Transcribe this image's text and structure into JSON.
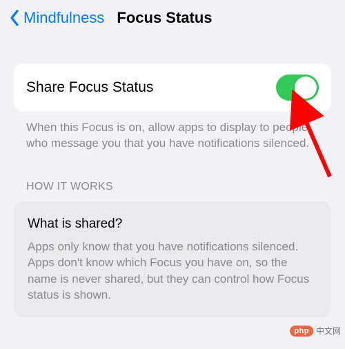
{
  "navbar": {
    "back_label": "Mindfulness",
    "title": "Focus Status"
  },
  "share_setting": {
    "label": "Share Focus Status",
    "enabled": true,
    "footer": "When this Focus is on, allow apps to display to people who message you that you have notifications silenced."
  },
  "how_it_works": {
    "header": "HOW IT WORKS",
    "card_title": "What is shared?",
    "card_body": "Apps only know that you have notifications silenced. Apps don't know which Focus you have on, so the name is never shared, but they can control how Focus status is shown."
  },
  "watermark": {
    "pill": "php",
    "text": "中文网"
  },
  "colors": {
    "accent": "#007aff",
    "switch_on": "#34c759",
    "bg": "#f2f2f7",
    "arrow": "#ff0000"
  }
}
